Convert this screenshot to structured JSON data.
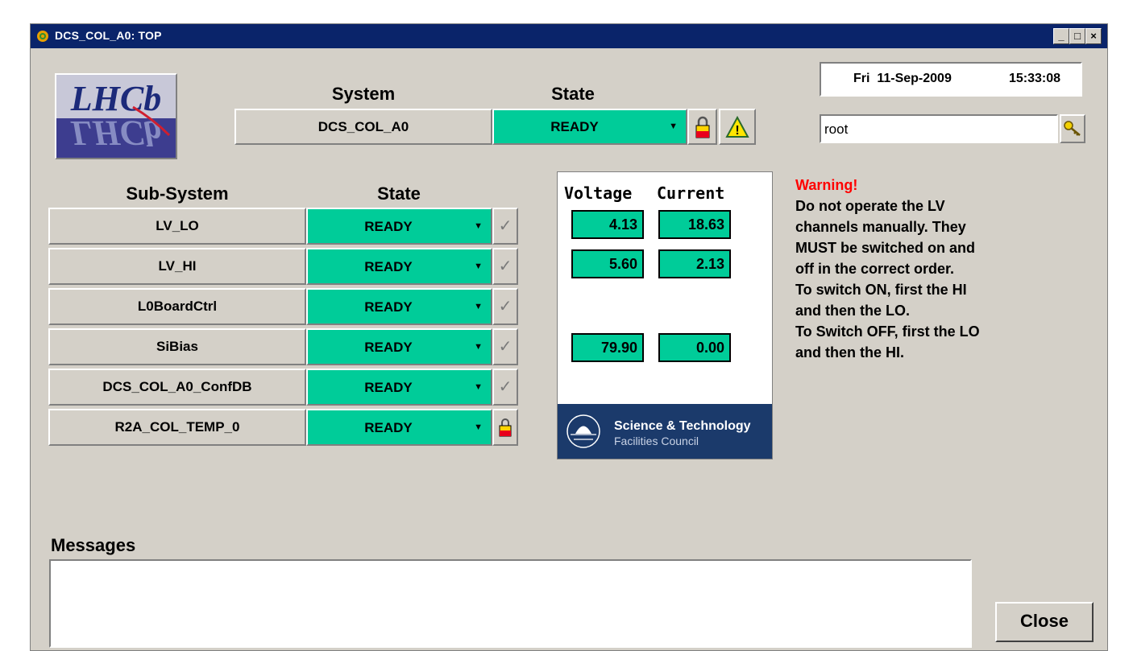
{
  "window": {
    "title": "DCS_COL_A0: TOP"
  },
  "logo": {
    "text": "LHCb"
  },
  "system": {
    "header_system": "System",
    "header_state": "State",
    "name": "DCS_COL_A0",
    "state": "READY"
  },
  "datetime": {
    "date": "Fri  11-Sep-2009",
    "time": "15:33:08"
  },
  "user": {
    "value": "root"
  },
  "subsystems": {
    "header_name": "Sub-System",
    "header_state": "State",
    "rows": [
      {
        "name": "LV_LO",
        "state": "READY",
        "icon": "check-icon"
      },
      {
        "name": "LV_HI",
        "state": "READY",
        "icon": "check-icon"
      },
      {
        "name": "L0BoardCtrl",
        "state": "READY",
        "icon": "check-icon"
      },
      {
        "name": "SiBias",
        "state": "READY",
        "icon": "check-icon"
      },
      {
        "name": "DCS_COL_A0_ConfDB",
        "state": "READY",
        "icon": "check-icon"
      },
      {
        "name": "R2A_COL_TEMP_0",
        "state": "READY",
        "icon": "lock-icon"
      }
    ]
  },
  "readings": {
    "voltage_label": "Voltage",
    "current_label": "Current",
    "rows": [
      {
        "voltage": "4.13",
        "current": "18.63"
      },
      {
        "voltage": "5.60",
        "current": "2.13"
      },
      {
        "voltage": "79.90",
        "current": "0.00"
      }
    ]
  },
  "stfc": {
    "line1": "Science & Technology",
    "line2": "Facilities Council"
  },
  "warning": {
    "title": "Warning!",
    "lines": [
      "Do not operate the LV",
      "channels manually. They",
      "MUST be switched on and",
      "off in the correct order.",
      "To switch ON, first the HI",
      "and then the LO.",
      "To Switch OFF, first the LO",
      "and then the HI."
    ]
  },
  "messages": {
    "label": "Messages"
  },
  "close_label": "Close",
  "colors": {
    "ready": "#00cc99",
    "titlebar": "#0a246a",
    "window": "#d4d0c8",
    "warning": "#ff0000",
    "stfc": "#1b3a6b"
  }
}
